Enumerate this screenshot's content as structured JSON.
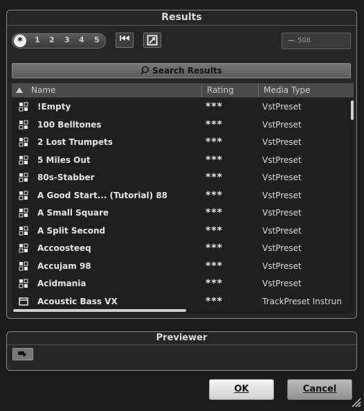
{
  "results_panel": {
    "title": "Results",
    "rating_filter": {
      "star": "*",
      "levels": [
        "1",
        "2",
        "3",
        "4",
        "5"
      ]
    },
    "result_count_field": "508",
    "search_button": "Search Results"
  },
  "table": {
    "columns": [
      "Name",
      "Rating",
      "Media Type"
    ],
    "rows": [
      {
        "name": "!Empty",
        "rating": "***",
        "media_type": "VstPreset",
        "icon": "vst-preset-icon"
      },
      {
        "name": "100 Belltones",
        "rating": "***",
        "media_type": "VstPreset",
        "icon": "vst-preset-icon"
      },
      {
        "name": "2 Lost Trumpets",
        "rating": "***",
        "media_type": "VstPreset",
        "icon": "vst-preset-icon"
      },
      {
        "name": "5 Miles Out",
        "rating": "***",
        "media_type": "VstPreset",
        "icon": "vst-preset-icon"
      },
      {
        "name": "80s-Stabber",
        "rating": "***",
        "media_type": "VstPreset",
        "icon": "vst-preset-icon"
      },
      {
        "name": "A Good Start... (Tutorial) 88",
        "rating": "***",
        "media_type": "VstPreset",
        "icon": "vst-preset-icon"
      },
      {
        "name": "A Small Square",
        "rating": "***",
        "media_type": "VstPreset",
        "icon": "vst-preset-icon"
      },
      {
        "name": "A Split Second",
        "rating": "***",
        "media_type": "VstPreset",
        "icon": "vst-preset-icon"
      },
      {
        "name": "Accoosteeq",
        "rating": "***",
        "media_type": "VstPreset",
        "icon": "vst-preset-icon"
      },
      {
        "name": "Accujam 98",
        "rating": "***",
        "media_type": "VstPreset",
        "icon": "vst-preset-icon"
      },
      {
        "name": "Acidmania",
        "rating": "***",
        "media_type": "VstPreset",
        "icon": "vst-preset-icon"
      },
      {
        "name": "Acoustic Bass VX",
        "rating": "***",
        "media_type": "TrackPreset Instrun",
        "icon": "track-preset-icon"
      }
    ]
  },
  "previewer": {
    "title": "Previewer"
  },
  "buttons": {
    "ok": "OK",
    "cancel": "Cancel"
  }
}
